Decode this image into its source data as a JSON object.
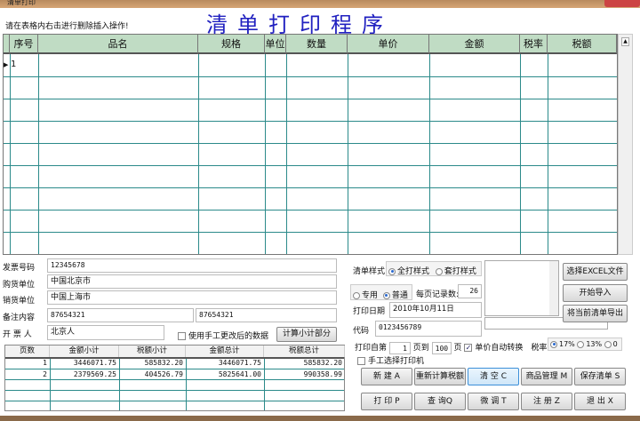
{
  "window": {
    "title": "清单打印"
  },
  "hint": "请在表格内右击进行删除插入操作!",
  "app_title": "清单打印程序",
  "grid": {
    "columns": [
      "序号",
      "品名",
      "规格",
      "单位",
      "数量",
      "单价",
      "金额",
      "税率",
      "税额"
    ],
    "rows": [
      [
        "1",
        "",
        "",
        "",
        "",
        "",
        "",
        "",
        ""
      ]
    ]
  },
  "form": {
    "invoice_no_label": "发票号码",
    "invoice_no": "12345678",
    "buyer_label": "购货单位",
    "buyer": "中国北京市",
    "seller_label": "销货单位",
    "seller": "中国上海市",
    "note_label": "备注内容",
    "note1": "87654321",
    "note2": "87654321",
    "issuer_label": "开 票 人",
    "issuer": "北京人",
    "manual_data_label": "使用手工更改后的数据",
    "calc_subtotal": "计算小计部分"
  },
  "subtotals": {
    "columns": [
      "页数",
      "金额小计",
      "税额小计",
      "金额总计",
      "税额总计"
    ],
    "rows": [
      [
        "1",
        "3446071.75",
        "585832.20",
        "3446071.75",
        "585832.20"
      ],
      [
        "2",
        "2379569.25",
        "404526.79",
        "5825641.00",
        "990358.99"
      ]
    ]
  },
  "right": {
    "style_label": "清单样式",
    "style_full": "全打样式",
    "style_overlay": "套打样式",
    "type_special": "专用",
    "type_normal": "普通",
    "per_page_label": "每页记录数:",
    "per_page": "26",
    "date_label": "打印日期",
    "date": "2010年10月11日",
    "code_label": "代码",
    "code": "0123456789",
    "print_from_label": "打印自第",
    "from": "1",
    "to_label": "页到",
    "to": "100",
    "page_label": "页",
    "auto_convert": "单价自动转换",
    "tax_label": "税率",
    "tax17": "17%",
    "tax13": "13%",
    "tax0": "0",
    "manual_printer": "手工选择打印机",
    "select_excel": "选择EXCEL文件",
    "start_import": "开始导入",
    "export": "将当前清单导出"
  },
  "buttons": {
    "new": "新 建 A",
    "recalc": "重新计算税额",
    "clear": "清 空 C",
    "goods": "商品管理 M",
    "save": "保存清单 S",
    "print": "打 印 P",
    "query": "查 询Q",
    "adjust": "微 调 T",
    "register": "注 册 Z",
    "exit": "退 出 X"
  }
}
